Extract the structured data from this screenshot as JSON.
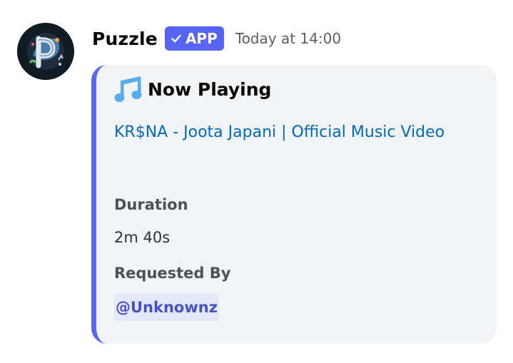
{
  "message": {
    "author": "Puzzle",
    "badge": {
      "label": "APP",
      "color": "#5865f2",
      "icon": "check-icon"
    },
    "timestamp": "Today at 14:00",
    "avatar_icon": "puzzle-p-avatar"
  },
  "embed": {
    "accent_color": "#5865f2",
    "title": "Now Playing",
    "title_icon": "music-note-icon",
    "link_text": "KR$NA - Joota Japani | Official Music Video",
    "fields": [
      {
        "name": "Duration",
        "value": "2m 40s"
      },
      {
        "name": "Requested By",
        "value": "@Unknownz"
      }
    ]
  }
}
